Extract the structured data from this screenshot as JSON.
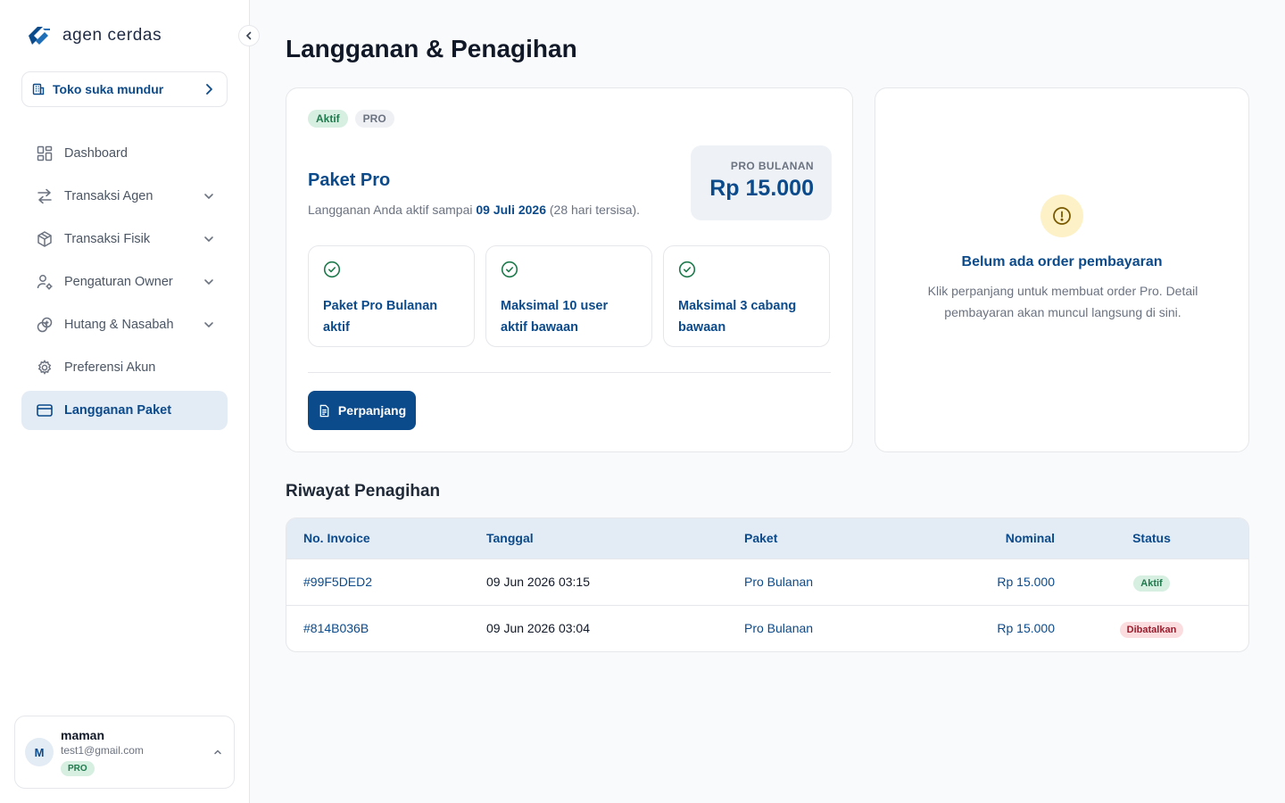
{
  "brand": {
    "name": "agen cerdas"
  },
  "store": {
    "label": "Toko suka mundur"
  },
  "sidebar": {
    "items": [
      {
        "label": "Dashboard",
        "icon": "grid-icon",
        "has_children": false
      },
      {
        "label": "Transaksi Agen",
        "icon": "arrows-swap-icon",
        "has_children": true
      },
      {
        "label": "Transaksi Fisik",
        "icon": "box-icon",
        "has_children": true
      },
      {
        "label": "Pengaturan Owner",
        "icon": "user-gear-icon",
        "has_children": true
      },
      {
        "label": "Hutang & Nasabah",
        "icon": "coins-icon",
        "has_children": true
      },
      {
        "label": "Preferensi Akun",
        "icon": "gear-icon",
        "has_children": false
      },
      {
        "label": "Langganan Paket",
        "icon": "credit-card-icon",
        "has_children": false,
        "active": true
      }
    ]
  },
  "user": {
    "initial": "M",
    "name": "maman",
    "email": "test1@gmail.com",
    "plan": "PRO"
  },
  "page": {
    "title": "Langganan & Penagihan"
  },
  "plan": {
    "status_badge": "Aktif",
    "tier_badge": "PRO",
    "name": "Paket Pro",
    "desc_prefix": "Langganan Anda aktif sampai ",
    "active_until": "09 Juli 2026",
    "desc_suffix": " (28 hari tersisa).",
    "price_label": "PRO BULANAN",
    "price_value": "Rp 15.000",
    "features": [
      "Paket Pro Bulanan aktif",
      "Maksimal 10 user aktif bawaan",
      "Maksimal 3 cabang bawaan"
    ],
    "renew_label": "Perpanjang"
  },
  "order": {
    "title": "Belum ada order pembayaran",
    "desc": "Klik perpanjang untuk membuat order Pro. Detail pembayaran akan muncul langsung di sini."
  },
  "history": {
    "title": "Riwayat Penagihan",
    "columns": [
      "No. Invoice",
      "Tanggal",
      "Paket",
      "Nominal",
      "Status"
    ],
    "rows": [
      {
        "invoice": "#99F5DED2",
        "date": "09 Jun 2026 03:15",
        "package": "Pro Bulanan",
        "amount": "Rp 15.000",
        "status": "Aktif"
      },
      {
        "invoice": "#814B036B",
        "date": "09 Jun 2026 03:04",
        "package": "Pro Bulanan",
        "amount": "Rp 15.000",
        "status": "Dibatalkan"
      }
    ]
  },
  "colors": {
    "primary": "#0b4a8b",
    "success": "#1e7a4c",
    "danger": "#9b1c2c",
    "warning_bg": "#fdf1c7"
  }
}
